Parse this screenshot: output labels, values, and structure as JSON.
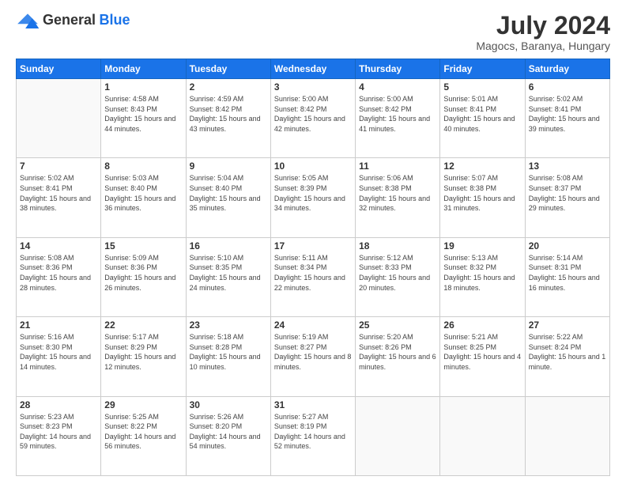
{
  "logo": {
    "general": "General",
    "blue": "Blue"
  },
  "title": {
    "month": "July 2024",
    "location": "Magocs, Baranya, Hungary"
  },
  "weekdays": [
    "Sunday",
    "Monday",
    "Tuesday",
    "Wednesday",
    "Thursday",
    "Friday",
    "Saturday"
  ],
  "weeks": [
    [
      {
        "day": "",
        "sunrise": "",
        "sunset": "",
        "daylight": ""
      },
      {
        "day": "1",
        "sunrise": "Sunrise: 4:58 AM",
        "sunset": "Sunset: 8:43 PM",
        "daylight": "Daylight: 15 hours and 44 minutes."
      },
      {
        "day": "2",
        "sunrise": "Sunrise: 4:59 AM",
        "sunset": "Sunset: 8:42 PM",
        "daylight": "Daylight: 15 hours and 43 minutes."
      },
      {
        "day": "3",
        "sunrise": "Sunrise: 5:00 AM",
        "sunset": "Sunset: 8:42 PM",
        "daylight": "Daylight: 15 hours and 42 minutes."
      },
      {
        "day": "4",
        "sunrise": "Sunrise: 5:00 AM",
        "sunset": "Sunset: 8:42 PM",
        "daylight": "Daylight: 15 hours and 41 minutes."
      },
      {
        "day": "5",
        "sunrise": "Sunrise: 5:01 AM",
        "sunset": "Sunset: 8:41 PM",
        "daylight": "Daylight: 15 hours and 40 minutes."
      },
      {
        "day": "6",
        "sunrise": "Sunrise: 5:02 AM",
        "sunset": "Sunset: 8:41 PM",
        "daylight": "Daylight: 15 hours and 39 minutes."
      }
    ],
    [
      {
        "day": "7",
        "sunrise": "Sunrise: 5:02 AM",
        "sunset": "Sunset: 8:41 PM",
        "daylight": "Daylight: 15 hours and 38 minutes."
      },
      {
        "day": "8",
        "sunrise": "Sunrise: 5:03 AM",
        "sunset": "Sunset: 8:40 PM",
        "daylight": "Daylight: 15 hours and 36 minutes."
      },
      {
        "day": "9",
        "sunrise": "Sunrise: 5:04 AM",
        "sunset": "Sunset: 8:40 PM",
        "daylight": "Daylight: 15 hours and 35 minutes."
      },
      {
        "day": "10",
        "sunrise": "Sunrise: 5:05 AM",
        "sunset": "Sunset: 8:39 PM",
        "daylight": "Daylight: 15 hours and 34 minutes."
      },
      {
        "day": "11",
        "sunrise": "Sunrise: 5:06 AM",
        "sunset": "Sunset: 8:38 PM",
        "daylight": "Daylight: 15 hours and 32 minutes."
      },
      {
        "day": "12",
        "sunrise": "Sunrise: 5:07 AM",
        "sunset": "Sunset: 8:38 PM",
        "daylight": "Daylight: 15 hours and 31 minutes."
      },
      {
        "day": "13",
        "sunrise": "Sunrise: 5:08 AM",
        "sunset": "Sunset: 8:37 PM",
        "daylight": "Daylight: 15 hours and 29 minutes."
      }
    ],
    [
      {
        "day": "14",
        "sunrise": "Sunrise: 5:08 AM",
        "sunset": "Sunset: 8:36 PM",
        "daylight": "Daylight: 15 hours and 28 minutes."
      },
      {
        "day": "15",
        "sunrise": "Sunrise: 5:09 AM",
        "sunset": "Sunset: 8:36 PM",
        "daylight": "Daylight: 15 hours and 26 minutes."
      },
      {
        "day": "16",
        "sunrise": "Sunrise: 5:10 AM",
        "sunset": "Sunset: 8:35 PM",
        "daylight": "Daylight: 15 hours and 24 minutes."
      },
      {
        "day": "17",
        "sunrise": "Sunrise: 5:11 AM",
        "sunset": "Sunset: 8:34 PM",
        "daylight": "Daylight: 15 hours and 22 minutes."
      },
      {
        "day": "18",
        "sunrise": "Sunrise: 5:12 AM",
        "sunset": "Sunset: 8:33 PM",
        "daylight": "Daylight: 15 hours and 20 minutes."
      },
      {
        "day": "19",
        "sunrise": "Sunrise: 5:13 AM",
        "sunset": "Sunset: 8:32 PM",
        "daylight": "Daylight: 15 hours and 18 minutes."
      },
      {
        "day": "20",
        "sunrise": "Sunrise: 5:14 AM",
        "sunset": "Sunset: 8:31 PM",
        "daylight": "Daylight: 15 hours and 16 minutes."
      }
    ],
    [
      {
        "day": "21",
        "sunrise": "Sunrise: 5:16 AM",
        "sunset": "Sunset: 8:30 PM",
        "daylight": "Daylight: 15 hours and 14 minutes."
      },
      {
        "day": "22",
        "sunrise": "Sunrise: 5:17 AM",
        "sunset": "Sunset: 8:29 PM",
        "daylight": "Daylight: 15 hours and 12 minutes."
      },
      {
        "day": "23",
        "sunrise": "Sunrise: 5:18 AM",
        "sunset": "Sunset: 8:28 PM",
        "daylight": "Daylight: 15 hours and 10 minutes."
      },
      {
        "day": "24",
        "sunrise": "Sunrise: 5:19 AM",
        "sunset": "Sunset: 8:27 PM",
        "daylight": "Daylight: 15 hours and 8 minutes."
      },
      {
        "day": "25",
        "sunrise": "Sunrise: 5:20 AM",
        "sunset": "Sunset: 8:26 PM",
        "daylight": "Daylight: 15 hours and 6 minutes."
      },
      {
        "day": "26",
        "sunrise": "Sunrise: 5:21 AM",
        "sunset": "Sunset: 8:25 PM",
        "daylight": "Daylight: 15 hours and 4 minutes."
      },
      {
        "day": "27",
        "sunrise": "Sunrise: 5:22 AM",
        "sunset": "Sunset: 8:24 PM",
        "daylight": "Daylight: 15 hours and 1 minute."
      }
    ],
    [
      {
        "day": "28",
        "sunrise": "Sunrise: 5:23 AM",
        "sunset": "Sunset: 8:23 PM",
        "daylight": "Daylight: 14 hours and 59 minutes."
      },
      {
        "day": "29",
        "sunrise": "Sunrise: 5:25 AM",
        "sunset": "Sunset: 8:22 PM",
        "daylight": "Daylight: 14 hours and 56 minutes."
      },
      {
        "day": "30",
        "sunrise": "Sunrise: 5:26 AM",
        "sunset": "Sunset: 8:20 PM",
        "daylight": "Daylight: 14 hours and 54 minutes."
      },
      {
        "day": "31",
        "sunrise": "Sunrise: 5:27 AM",
        "sunset": "Sunset: 8:19 PM",
        "daylight": "Daylight: 14 hours and 52 minutes."
      },
      {
        "day": "",
        "sunrise": "",
        "sunset": "",
        "daylight": ""
      },
      {
        "day": "",
        "sunrise": "",
        "sunset": "",
        "daylight": ""
      },
      {
        "day": "",
        "sunrise": "",
        "sunset": "",
        "daylight": ""
      }
    ]
  ]
}
